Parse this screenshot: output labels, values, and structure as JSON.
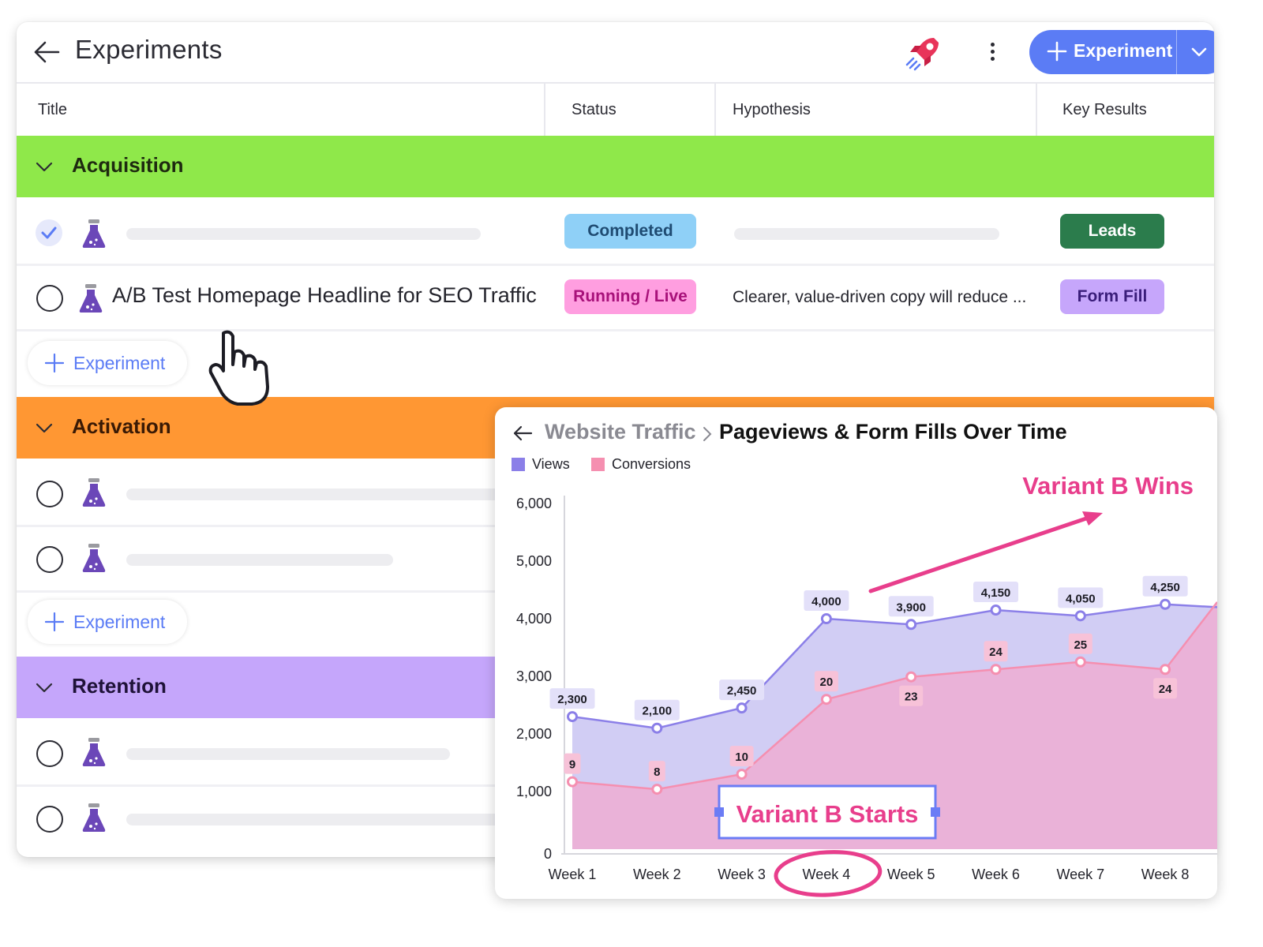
{
  "header": {
    "title": "Experiments",
    "new_button_label": "Experiment"
  },
  "columns": [
    "Title",
    "Status",
    "Hypothesis",
    "Key Results"
  ],
  "groups": [
    {
      "name": "Acquisition",
      "color": "#8fe84a",
      "rows": [
        {
          "checked": true,
          "title": "",
          "status": "Completed",
          "status_color": "#8fd0f7",
          "status_text_color": "#1f4b72",
          "hypothesis": "",
          "key_result": "Leads",
          "key_result_color": "#2b7c4c",
          "key_result_text_color": "#ffffff"
        },
        {
          "checked": false,
          "title": "A/B Test Homepage Headline for SEO Traffic",
          "status": "Running / Live",
          "status_color": "#ff9ee0",
          "status_text_color": "#a8117a",
          "hypothesis": "Clearer, value-driven copy will reduce ...",
          "key_result": "Form Fill",
          "key_result_color": "#c6a6fb",
          "key_result_text_color": "#3a1d7a"
        }
      ],
      "add_label": "Experiment"
    },
    {
      "name": "Activation",
      "color": "#ff9733",
      "rows": [
        {
          "checked": false
        },
        {
          "checked": false
        }
      ],
      "add_label": "Experiment"
    },
    {
      "name": "Retention",
      "color": "#c5a6fb",
      "rows": [
        {
          "checked": false
        },
        {
          "checked": false
        }
      ]
    }
  ],
  "chart_panel": {
    "breadcrumb_parent": "Website Traffic",
    "breadcrumb_current": "Pageviews & Form Fills Over Time"
  },
  "chart_data": {
    "type": "area",
    "x": [
      "Week 1",
      "Week 2",
      "Week 3",
      "Week 4",
      "Week 5",
      "Week 6",
      "Week 7",
      "Week 8"
    ],
    "series": [
      {
        "name": "Views",
        "color": "#8b7fe8",
        "fill": "#cfcaf3",
        "values": [
          2300,
          2100,
          2450,
          4000,
          3900,
          4150,
          4050,
          4250
        ],
        "labels": [
          "2,300",
          "2,100",
          "2,450",
          "4,000",
          "3,900",
          "4,150",
          "4,050",
          "4,250"
        ]
      },
      {
        "name": "Conversions",
        "color": "#f58fb0",
        "fill": "#ebb0d6",
        "values": [
          9,
          8,
          10,
          20,
          23,
          24,
          25,
          24
        ],
        "labels": [
          "9",
          "8",
          "10",
          "20",
          "23",
          "24",
          "25",
          "24"
        ]
      }
    ],
    "y_ticks": [
      "0",
      "1,000",
      "2,000",
      "3,000",
      "4,000",
      "5,000",
      "6,000"
    ],
    "ylim": [
      0,
      6000
    ],
    "legend": "top-left",
    "annotations": {
      "variant_b_starts": "Variant B Starts",
      "variant_b_wins": "Variant B Wins",
      "highlighted_tick": "Week 4"
    }
  }
}
